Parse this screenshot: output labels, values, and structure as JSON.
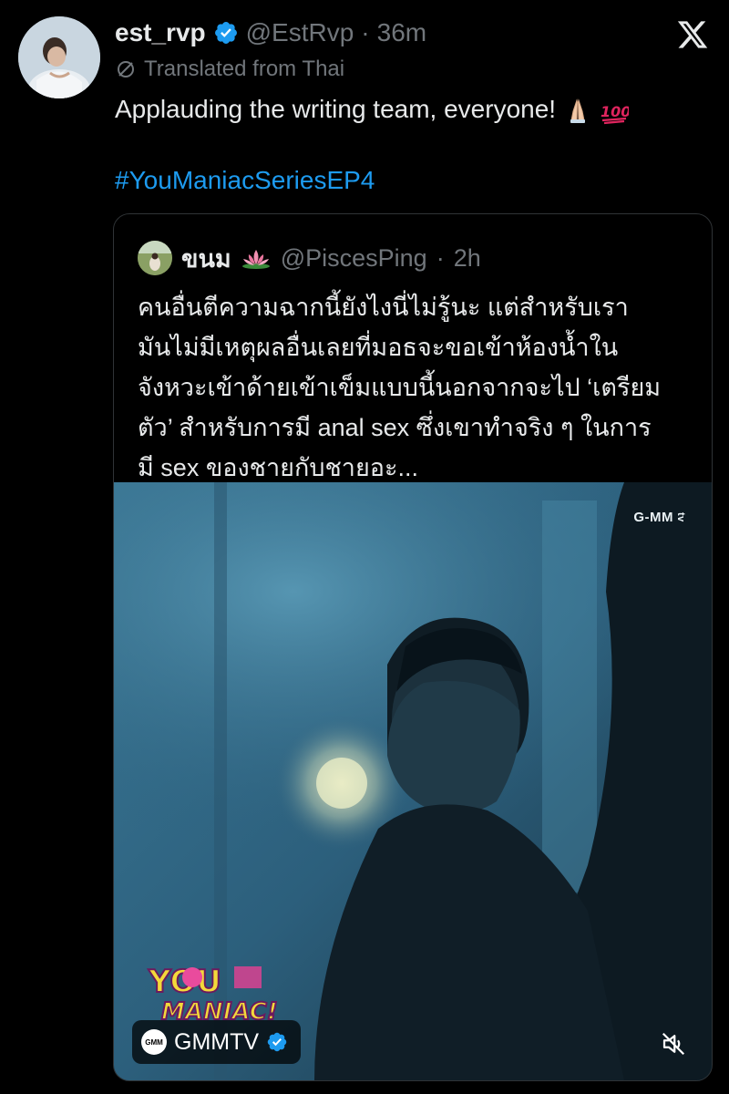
{
  "tweet": {
    "display_name": "est_rvp",
    "handle": "@EstRvp",
    "separator": "·",
    "time": "36m",
    "translated_label": "Translated from Thai",
    "text": "Applauding the writing team, everyone!",
    "emojis": [
      "folded-hands",
      "hundred-points"
    ],
    "hashtag": "#YouManiacSeriesEP4"
  },
  "quote": {
    "display_name": "ขนม",
    "handle": "@PiscesPing",
    "separator": "·",
    "time": "2h",
    "text_lines": [
      "คนอื่นตีความฉากนี้ยังไงนี่ไม่รู้นะ แต่สำหรับเรา",
      "มันไม่มีเหตุผลอื่นเลยที่มอธจะขอเข้าห้องน้ำใน",
      "จังหวะเข้าด้ายเข้าเข็มแบบนี้นอกจากจะไป ‘เตรียม",
      "ตัว’ สำหรับการมี anal sex ซึ่งเขาทำจริง ๆ ในการ",
      "มี sex ของชายกับชายอะ..."
    ],
    "video": {
      "watermark": "G-MM",
      "watermark_suffix": "tv",
      "show_logo_text": "YOU MANIAC!",
      "source_name": "GMMTV",
      "source_logo_text": "GMM"
    }
  },
  "colors": {
    "background": "#000000",
    "text_primary": "#e7e9ea",
    "text_secondary": "#71767b",
    "link": "#1d9bf0",
    "verified": "#1d9bf0",
    "border": "#2f3336"
  },
  "icons": {
    "verified": "verified-badge-icon",
    "x_logo": "x-logo-icon",
    "translate": "translate-icon",
    "lotus": "lotus-icon",
    "mute": "speaker-muted-icon"
  }
}
